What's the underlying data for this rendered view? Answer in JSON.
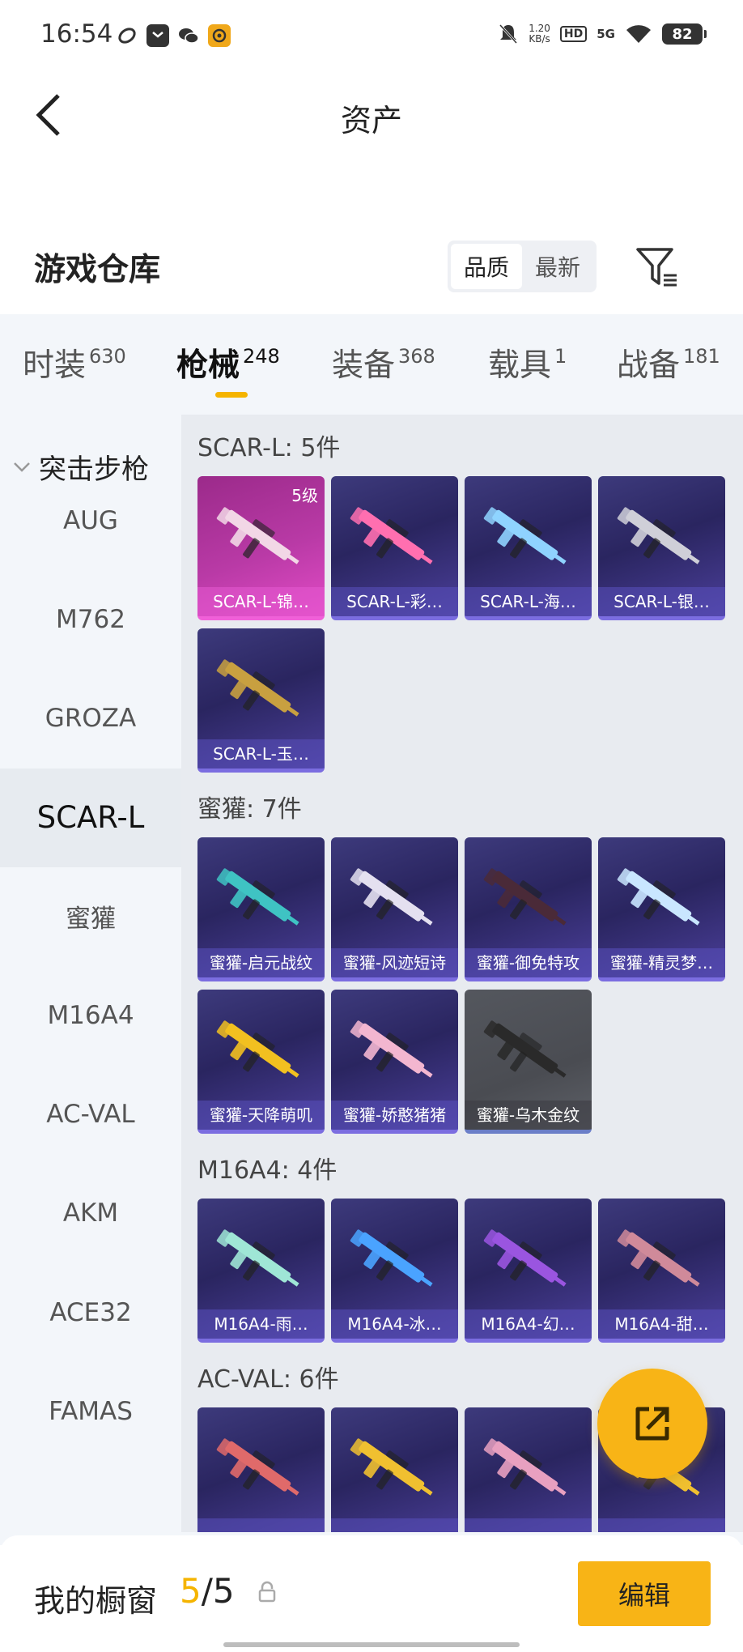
{
  "status": {
    "time": "16:54",
    "net_speed": "1.20",
    "net_unit": "KB/s",
    "hd": "HD",
    "network": "5G",
    "battery": "82"
  },
  "nav": {
    "title": "资产"
  },
  "warehouse": {
    "title": "游戏仓库",
    "sort": [
      "品质",
      "最新"
    ]
  },
  "tabs": [
    {
      "label": "时装",
      "count": "630"
    },
    {
      "label": "枪械",
      "count": "248"
    },
    {
      "label": "装备",
      "count": "368"
    },
    {
      "label": "载具",
      "count": "1"
    },
    {
      "label": "战备",
      "count": "181"
    }
  ],
  "sidebar": {
    "category": "突击步枪",
    "items": [
      "AUG",
      "M762",
      "GROZA",
      "SCAR-L",
      "蜜獾",
      "M16A4",
      "AC-VAL",
      "AKM",
      "ACE32",
      "FAMAS"
    ],
    "active": "SCAR-L"
  },
  "groups": [
    {
      "title": "SCAR-L: 5件",
      "items": [
        {
          "name": "SCAR-L-锦…",
          "level": "5级",
          "style": "pink",
          "gun": "#f2d7e6"
        },
        {
          "name": "SCAR-L-彩…",
          "style": "purple",
          "gun": "#ff6fb0"
        },
        {
          "name": "SCAR-L-海…",
          "style": "purple",
          "gun": "#8fd3ff"
        },
        {
          "name": "SCAR-L-银…",
          "style": "purple",
          "gun": "#cfcfd8"
        },
        {
          "name": "SCAR-L-玉…",
          "style": "purple",
          "gun": "#c8a040"
        }
      ]
    },
    {
      "title": "蜜獾: 7件",
      "items": [
        {
          "name": "蜜獾-启元战纹",
          "style": "purple",
          "gun": "#3fc3c3"
        },
        {
          "name": "蜜獾-风迹短诗",
          "style": "purple",
          "gun": "#e4e0f0"
        },
        {
          "name": "蜜獾-御免特攻",
          "style": "purple",
          "gun": "#4a2a38"
        },
        {
          "name": "蜜獾-精灵梦…",
          "style": "purple",
          "gun": "#c9e6ff"
        },
        {
          "name": "蜜獾-天降萌叽",
          "style": "purple",
          "gun": "#f2c020"
        },
        {
          "name": "蜜獾-娇憨猪猪",
          "style": "purple",
          "gun": "#f3b6d0"
        },
        {
          "name": "蜜獾-乌木金纹",
          "style": "gray",
          "gun": "#2a2a2a"
        }
      ]
    },
    {
      "title": "M16A4: 4件",
      "items": [
        {
          "name": "M16A4-雨…",
          "style": "purple",
          "gun": "#9fe6d6"
        },
        {
          "name": "M16A4-冰…",
          "style": "purple",
          "gun": "#4aa3ff"
        },
        {
          "name": "M16A4-幻…",
          "style": "purple",
          "gun": "#9a55e0"
        },
        {
          "name": "M16A4-甜…",
          "style": "purple",
          "gun": "#d08a9a"
        }
      ]
    },
    {
      "title": "AC-VAL: 6件",
      "items": [
        {
          "name": "",
          "style": "purple",
          "gun": "#e06a6a"
        },
        {
          "name": "",
          "style": "purple",
          "gun": "#f0c030"
        },
        {
          "name": "",
          "style": "purple",
          "gun": "#e8a0c0"
        },
        {
          "name": "",
          "style": "purple",
          "gun": "#f0c030"
        }
      ]
    }
  ],
  "bottom": {
    "label": "我的橱窗",
    "count_used": "5",
    "count_total": "/5",
    "edit": "编辑"
  }
}
